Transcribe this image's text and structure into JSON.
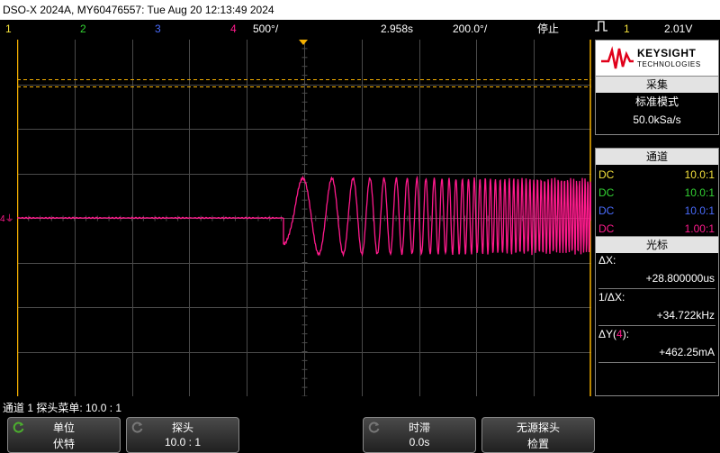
{
  "title_bar": "DSO-X 2024A, MY60476557: Tue Aug 20 12:13:49 2024",
  "status": {
    "ch1": "1",
    "ch2": "2",
    "ch3": "3",
    "ch4": "4",
    "ch4_scale": "500°/",
    "time_delay": "2.958s",
    "time_scale": "200.0°/",
    "run_state": "停止",
    "trigger_source": "1",
    "trigger_level": "2.01V"
  },
  "colors": {
    "ch1": "#f5e23c",
    "ch2": "#33d333",
    "ch3": "#4a6cff",
    "ch4": "#ff1a8c",
    "grid": "#4a4a4a"
  },
  "ground_marker": "4",
  "logo": {
    "brand": "KEYSIGHT",
    "sub": "TECHNOLOGIES"
  },
  "acquisition": {
    "header": "采集",
    "mode": "标准模式",
    "rate": "50.0kSa/s"
  },
  "channels": {
    "header": "通道",
    "rows": [
      {
        "coupling": "DC",
        "probe": "10.0:1"
      },
      {
        "coupling": "DC",
        "probe": "10.0:1"
      },
      {
        "coupling": "DC",
        "probe": "10.0:1"
      },
      {
        "coupling": "DC",
        "probe": "1.00:1"
      }
    ]
  },
  "cursors": {
    "header": "光标",
    "dx_label": "ΔX:",
    "dx_value": "+28.800000us",
    "inv_label": "1/ΔX:",
    "inv_value": "+34.722kHz",
    "dy_label_pre": "ΔY(",
    "dy_label_ch": "4",
    "dy_label_post": "):",
    "dy_value": "+462.25mA"
  },
  "message": "通道 1 探头菜单: 10.0 : 1",
  "softkeys": [
    {
      "top": "单位",
      "bottom": "伏特",
      "icon": "rotate-knob-icon"
    },
    {
      "top": "探头",
      "bottom": "10.0 : 1",
      "icon": "rotate-knob-icon"
    },
    {
      "top": "",
      "bottom": "",
      "icon": ""
    },
    {
      "top": "时滞",
      "bottom": "0.0s",
      "icon": "rotate-knob-icon"
    },
    {
      "top": "无源探头",
      "bottom": "检置",
      "icon": ""
    }
  ]
}
